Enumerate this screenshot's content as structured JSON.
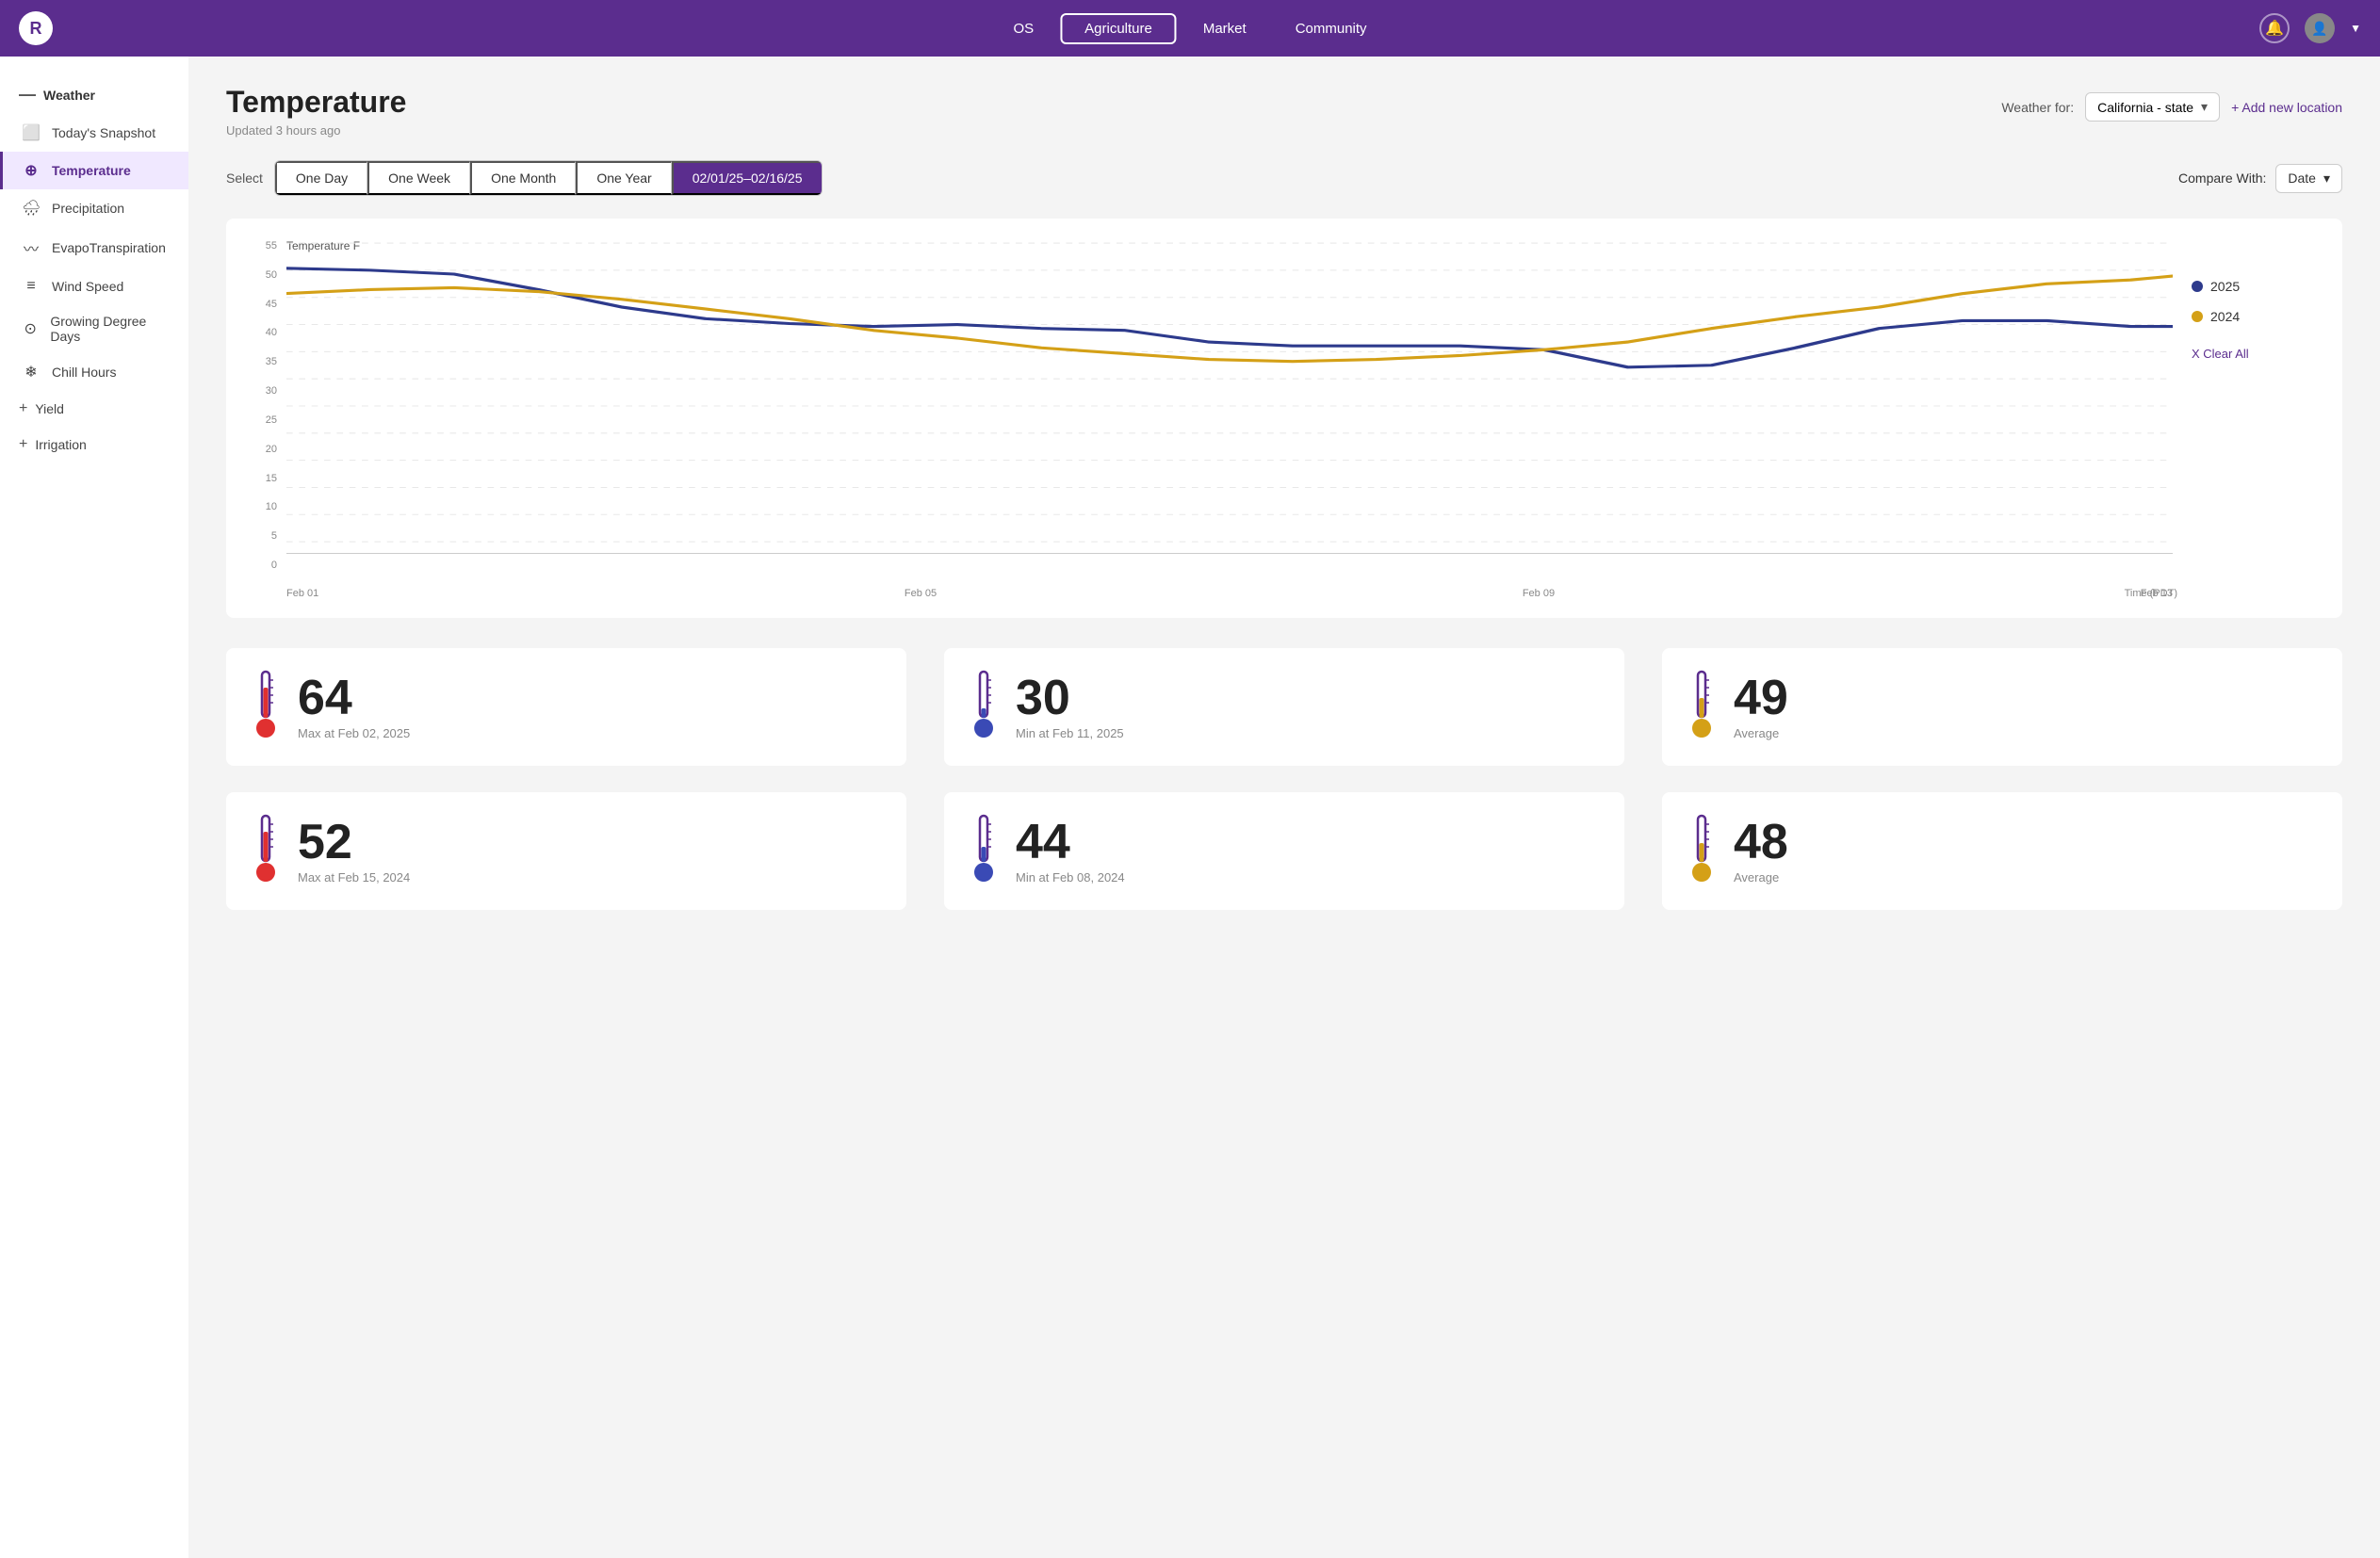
{
  "app": {
    "logo": "R"
  },
  "topnav": {
    "tabs": [
      {
        "id": "os",
        "label": "OS",
        "active": false
      },
      {
        "id": "agriculture",
        "label": "Agriculture",
        "active": true
      },
      {
        "id": "market",
        "label": "Market",
        "active": false
      },
      {
        "id": "community",
        "label": "Community",
        "active": false
      }
    ]
  },
  "sidebar": {
    "weather_section": "Weather",
    "items": [
      {
        "id": "snapshot",
        "label": "Today's Snapshot",
        "icon": "□",
        "active": false
      },
      {
        "id": "temperature",
        "label": "Temperature",
        "icon": "⊕",
        "active": true
      },
      {
        "id": "precipitation",
        "label": "Precipitation",
        "icon": "🌧",
        "active": false
      },
      {
        "id": "evapotranspiration",
        "label": "EvapoTranspiration",
        "icon": "≈",
        "active": false
      },
      {
        "id": "windspeed",
        "label": "Wind Speed",
        "icon": "≡",
        "active": false
      },
      {
        "id": "growingdegree",
        "label": "Growing Degree Days",
        "icon": "⊙",
        "active": false
      },
      {
        "id": "chillhours",
        "label": "Chill Hours",
        "icon": "⊛",
        "active": false
      }
    ],
    "groups": [
      {
        "id": "yield",
        "label": "Yield"
      },
      {
        "id": "irrigation",
        "label": "Irrigation"
      }
    ]
  },
  "page": {
    "title": "Temperature",
    "subtitle": "Updated 3 hours ago",
    "weather_for_label": "Weather for:",
    "location": "California - state",
    "add_location": "+ Add new location"
  },
  "select_bar": {
    "label": "Select",
    "time_tabs": [
      {
        "id": "one_day",
        "label": "One Day",
        "active": false
      },
      {
        "id": "one_week",
        "label": "One Week",
        "active": false
      },
      {
        "id": "one_month",
        "label": "One Month",
        "active": false
      },
      {
        "id": "one_year",
        "label": "One Year",
        "active": false
      },
      {
        "id": "custom",
        "label": "02/01/25–02/16/25",
        "active": true
      }
    ],
    "compare_with_label": "Compare With:",
    "compare_option": "Date"
  },
  "chart": {
    "y_axis_title": "Temperature F",
    "x_axis_title": "Time (PDT)",
    "y_labels": [
      "0",
      "5",
      "10",
      "15",
      "20",
      "25",
      "30",
      "35",
      "40",
      "45",
      "50",
      "55"
    ],
    "x_labels": [
      "Feb 01",
      "Feb 05",
      "Feb 09",
      "Feb 13"
    ],
    "legend": {
      "series": [
        {
          "id": "2025",
          "label": "2025",
          "color": "#2d3a8c"
        },
        {
          "id": "2024",
          "label": "2024",
          "color": "#d4a017"
        }
      ],
      "clear_all": "X Clear All"
    }
  },
  "stats": {
    "year_2025": [
      {
        "id": "max_2025",
        "value": "64",
        "label": "Max at Feb 02, 2025",
        "therm": "red"
      },
      {
        "id": "min_2025",
        "value": "30",
        "label": "Min at Feb 11, 2025",
        "therm": "blue"
      },
      {
        "id": "avg_2025",
        "value": "49",
        "label": "Average",
        "therm": "gold"
      }
    ],
    "year_2024": [
      {
        "id": "max_2024",
        "value": "52",
        "label": "Max at Feb 15, 2024",
        "therm": "red"
      },
      {
        "id": "min_2024",
        "value": "44",
        "label": "Min at Feb 08, 2024",
        "therm": "blue"
      },
      {
        "id": "avg_2024",
        "value": "48",
        "label": "Average",
        "therm": "gold"
      }
    ]
  }
}
